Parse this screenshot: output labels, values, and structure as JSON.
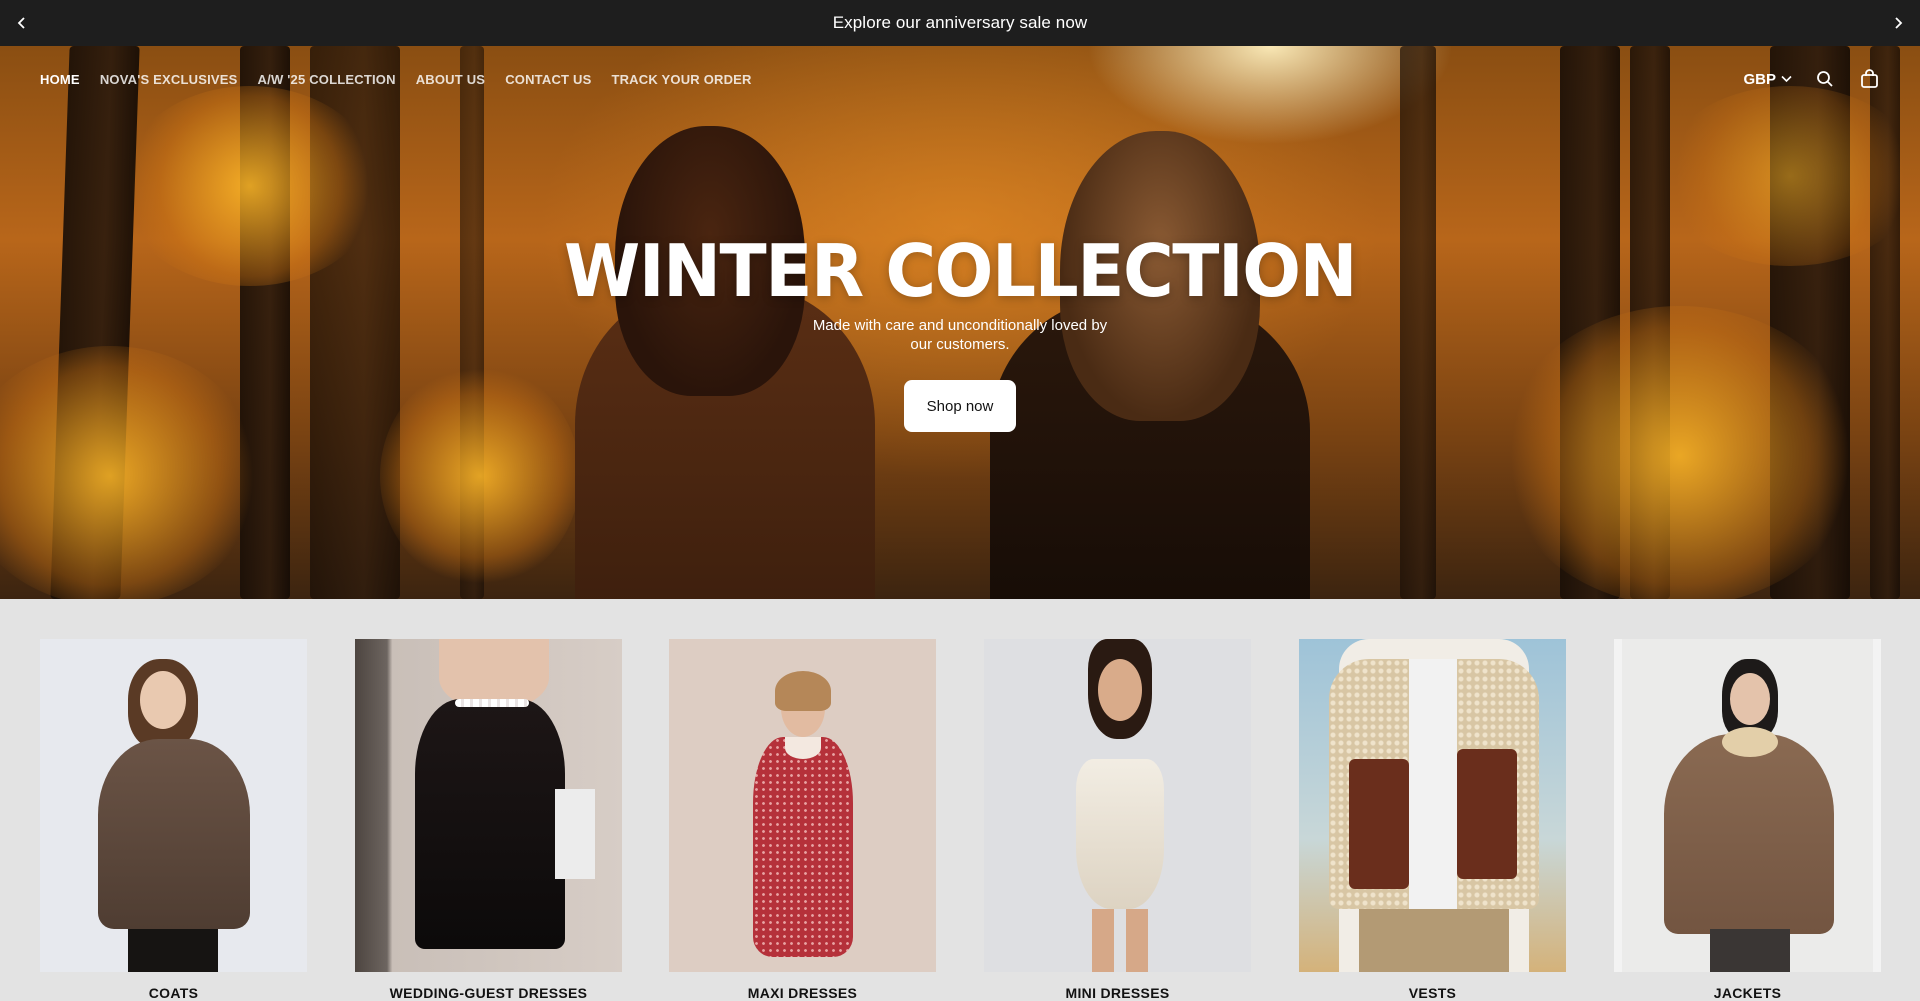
{
  "announcement": {
    "text": "Explore our anniversary sale now",
    "prev_icon": "chevron-left-icon",
    "next_icon": "chevron-right-icon"
  },
  "nav": {
    "links": [
      "HOME",
      "NOVA'S EXCLUSIVES",
      "A/W '25 COLLECTION",
      "ABOUT US",
      "CONTACT US",
      "TRACK YOUR ORDER"
    ],
    "active_link": "HOME",
    "currency": "GBP",
    "icons": [
      "chevron-down-icon",
      "search-icon",
      "cart-icon"
    ]
  },
  "hero": {
    "title": "WINTER COLLECTION",
    "subtitle": "Made with care and unconditionally loved by our customers.",
    "button": "Shop now"
  },
  "collections": [
    {
      "label": "COATS"
    },
    {
      "label": "WEDDING-GUEST DRESSES"
    },
    {
      "label": "MAXI DRESSES"
    },
    {
      "label": "MINI DRESSES"
    },
    {
      "label": "VESTS"
    },
    {
      "label": "JACKETS"
    }
  ],
  "colors": {
    "announcement_bg": "#1e1e1e",
    "page_bg": "#e3e3e3",
    "button_bg": "#ffffff",
    "text_dark": "#121212"
  }
}
